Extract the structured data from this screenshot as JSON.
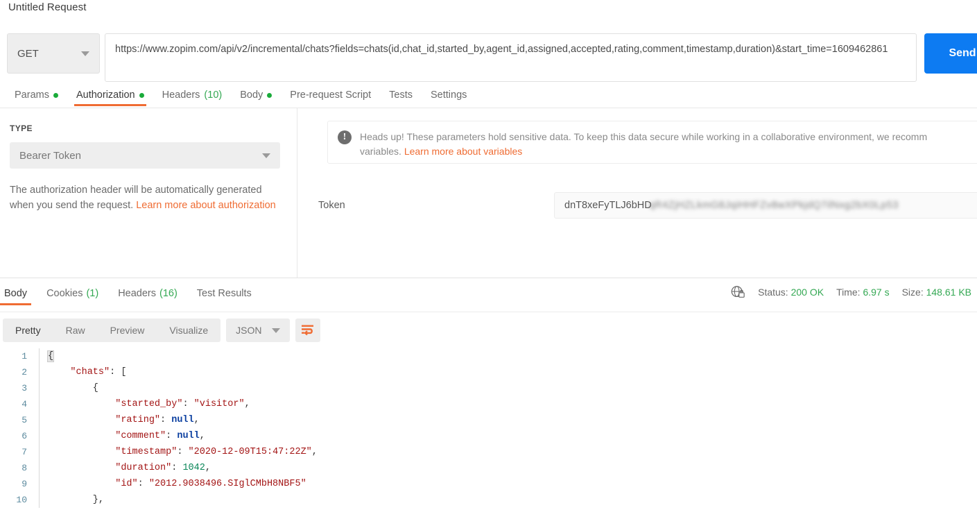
{
  "request": {
    "title": "Untitled Request",
    "method": "GET",
    "url": "https://www.zopim.com/api/v2/incremental/chats?fields=chats(id,chat_id,started_by,agent_id,assigned,accepted,rating,comment,timestamp,duration)&start_time=1609462861",
    "send_label": "Send",
    "send_color": "#0d7bf2",
    "tabs": [
      {
        "label": "Params",
        "dot": true,
        "count": "",
        "active": false
      },
      {
        "label": "Authorization",
        "dot": true,
        "count": "",
        "active": true
      },
      {
        "label": "Headers",
        "dot": false,
        "count": "(10)",
        "active": false
      },
      {
        "label": "Body",
        "dot": true,
        "count": "",
        "active": false
      },
      {
        "label": "Pre-request Script",
        "dot": false,
        "count": "",
        "active": false
      },
      {
        "label": "Tests",
        "dot": false,
        "count": "",
        "active": false
      },
      {
        "label": "Settings",
        "dot": false,
        "count": "",
        "active": false
      }
    ],
    "active_tab_color": "#ef6c33",
    "dot_color": "#1aab3a"
  },
  "auth": {
    "type_heading": "TYPE",
    "type_value": "Bearer Token",
    "description": "The authorization header will be automatically generated when you send the request. ",
    "description_link": "Learn more about authorization",
    "headsup": "Heads up! These parameters hold sensitive data. To keep this data secure while working in a collaborative environment, we recomm",
    "headsup_line2": "variables. ",
    "headsup_link": "Learn more about variables",
    "token_label": "Token",
    "token_value_visible": "dnT8xeFyTLJ6bHD",
    "token_value_blurred": "qR4ZjHZLkmG8JqiHHFZv8wXPkjdQ7ilNxg2bX0Lp53"
  },
  "response": {
    "tabs": [
      {
        "label": "Body",
        "count": "",
        "active": true
      },
      {
        "label": "Cookies",
        "count": "(1)",
        "active": false
      },
      {
        "label": "Headers",
        "count": "(16)",
        "active": false
      },
      {
        "label": "Test Results",
        "count": "",
        "active": false
      }
    ],
    "status_label": "Status:",
    "status_value": "200 OK",
    "time_label": "Time:",
    "time_value": "6.97 s",
    "size_label": "Size:",
    "size_value": "148.61 KB",
    "ok_color": "#34a853",
    "viewer": {
      "modes": [
        {
          "label": "Pretty",
          "active": true
        },
        {
          "label": "Raw",
          "active": false
        },
        {
          "label": "Preview",
          "active": false
        },
        {
          "label": "Visualize",
          "active": false
        }
      ],
      "format": "JSON",
      "wrap_icon": "word-wrap-icon"
    },
    "body_lines": [
      {
        "n": "1",
        "tokens": [
          {
            "t": "{",
            "c": "brace-hl"
          }
        ]
      },
      {
        "n": "2",
        "tokens": [
          {
            "t": "    ",
            "c": "p"
          },
          {
            "t": "\"chats\"",
            "c": "k"
          },
          {
            "t": ": [",
            "c": "p"
          }
        ]
      },
      {
        "n": "3",
        "tokens": [
          {
            "t": "        {",
            "c": "p"
          }
        ]
      },
      {
        "n": "4",
        "tokens": [
          {
            "t": "            ",
            "c": "p"
          },
          {
            "t": "\"started_by\"",
            "c": "k"
          },
          {
            "t": ": ",
            "c": "p"
          },
          {
            "t": "\"visitor\"",
            "c": "s"
          },
          {
            "t": ",",
            "c": "p"
          }
        ]
      },
      {
        "n": "5",
        "tokens": [
          {
            "t": "            ",
            "c": "p"
          },
          {
            "t": "\"rating\"",
            "c": "k"
          },
          {
            "t": ": ",
            "c": "p"
          },
          {
            "t": "null",
            "c": "nul"
          },
          {
            "t": ",",
            "c": "p"
          }
        ]
      },
      {
        "n": "6",
        "tokens": [
          {
            "t": "            ",
            "c": "p"
          },
          {
            "t": "\"comment\"",
            "c": "k"
          },
          {
            "t": ": ",
            "c": "p"
          },
          {
            "t": "null",
            "c": "nul"
          },
          {
            "t": ",",
            "c": "p"
          }
        ]
      },
      {
        "n": "7",
        "tokens": [
          {
            "t": "            ",
            "c": "p"
          },
          {
            "t": "\"timestamp\"",
            "c": "k"
          },
          {
            "t": ": ",
            "c": "p"
          },
          {
            "t": "\"2020-12-09T15:47:22Z\"",
            "c": "s"
          },
          {
            "t": ",",
            "c": "p"
          }
        ]
      },
      {
        "n": "8",
        "tokens": [
          {
            "t": "            ",
            "c": "p"
          },
          {
            "t": "\"duration\"",
            "c": "k"
          },
          {
            "t": ": ",
            "c": "p"
          },
          {
            "t": "1042",
            "c": "n"
          },
          {
            "t": ",",
            "c": "p"
          }
        ]
      },
      {
        "n": "9",
        "tokens": [
          {
            "t": "            ",
            "c": "p"
          },
          {
            "t": "\"id\"",
            "c": "k"
          },
          {
            "t": ": ",
            "c": "p"
          },
          {
            "t": "\"2012.9038496.SIglCMbH8NBF5\"",
            "c": "s"
          }
        ]
      },
      {
        "n": "10",
        "tokens": [
          {
            "t": "        },",
            "c": "p"
          }
        ]
      }
    ]
  }
}
